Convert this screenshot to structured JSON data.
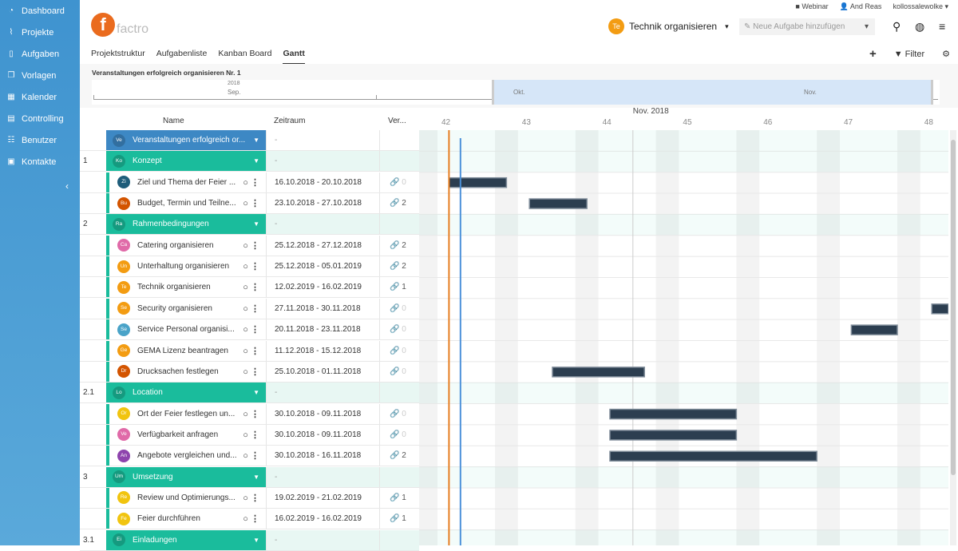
{
  "sidebar": {
    "items": [
      {
        "label": "Dashboard",
        "icon": "dashboard-icon",
        "glyph": "◔"
      },
      {
        "label": "Projekte",
        "icon": "chart-icon",
        "glyph": "⌇"
      },
      {
        "label": "Aufgaben",
        "icon": "file-icon",
        "glyph": "▯"
      },
      {
        "label": "Vorlagen",
        "icon": "copy-icon",
        "glyph": "❐"
      },
      {
        "label": "Kalender",
        "icon": "calendar-icon",
        "glyph": "▦"
      },
      {
        "label": "Controlling",
        "icon": "calculator-icon",
        "glyph": "▤"
      },
      {
        "label": "Benutzer",
        "icon": "users-icon",
        "glyph": "☷"
      },
      {
        "label": "Kontakte",
        "icon": "contact-icon",
        "glyph": "▣"
      }
    ],
    "collapse": "‹"
  },
  "logo": {
    "letter": "f",
    "text": "factro"
  },
  "topbar": {
    "webinar": "Webinar",
    "user": "And Reas",
    "account": "kollossalewolke ▾"
  },
  "context": {
    "initials": "Te",
    "title": "Technik organisieren",
    "chevron": "▾"
  },
  "new_task": {
    "placeholder": "Neue Aufgabe hinzufügen",
    "chevron": "▾"
  },
  "tabs": [
    {
      "label": "Projektstruktur"
    },
    {
      "label": "Aufgabenliste"
    },
    {
      "label": "Kanban Board"
    },
    {
      "label": "Gantt",
      "active": true
    }
  ],
  "toolbar": {
    "add": "+",
    "filter": "Filter"
  },
  "overview": {
    "title": "Veranstaltungen erfolgreich organisieren Nr. 1",
    "year": "2018",
    "months": [
      "Sep.",
      "Okt.",
      "Nov."
    ]
  },
  "columns": {
    "name": "Name",
    "period": "Zeitraum",
    "links": "Ver..."
  },
  "timeline": {
    "month": "Nov. 2018",
    "weeks": [
      42,
      43,
      44,
      45,
      46,
      47,
      48
    ]
  },
  "rows": [
    {
      "type": "root",
      "initials": "Ve",
      "name": "Veranstaltungen erfolgreich or...",
      "period": "-",
      "color": "#3d88c4"
    },
    {
      "type": "group",
      "num": "1",
      "initials": "Ko",
      "name": "Konzept",
      "period": "-"
    },
    {
      "type": "task",
      "initials": "Zi",
      "name": "Ziel und Thema der Feier ...",
      "period": "16.10.2018 - 20.10.2018",
      "links": "0",
      "color": "#1f5d7a",
      "start": "2018-10-16",
      "end": "2018-10-20"
    },
    {
      "type": "task",
      "initials": "Bu",
      "name": "Budget, Termin und Teilne...",
      "period": "23.10.2018 - 27.10.2018",
      "links": "2",
      "color": "#d35400",
      "start": "2018-10-23",
      "end": "2018-10-27"
    },
    {
      "type": "group",
      "num": "2",
      "initials": "Ra",
      "name": "Rahmenbedingungen",
      "period": "-"
    },
    {
      "type": "task",
      "initials": "Ca",
      "name": "Catering organisieren",
      "period": "25.12.2018 - 27.12.2018",
      "links": "2",
      "color": "#e06aa8",
      "start": "2018-12-25",
      "end": "2018-12-27"
    },
    {
      "type": "task",
      "initials": "Un",
      "name": "Unterhaltung organisieren",
      "period": "25.12.2018 - 05.01.2019",
      "links": "2",
      "color": "#f39c12",
      "start": "2018-12-25",
      "end": "2019-01-05"
    },
    {
      "type": "task",
      "initials": "Te",
      "name": "Technik organisieren",
      "period": "12.02.2019 - 16.02.2019",
      "links": "1",
      "color": "#f39c12",
      "start": "2019-02-12",
      "end": "2019-02-16"
    },
    {
      "type": "task",
      "initials": "Se",
      "name": "Security organisieren",
      "period": "27.11.2018 - 30.11.2018",
      "links": "0",
      "color": "#f39c12",
      "start": "2018-11-27",
      "end": "2018-11-30"
    },
    {
      "type": "task",
      "initials": "Se",
      "name": "Service Personal organisi...",
      "period": "20.11.2018 - 23.11.2018",
      "links": "0",
      "color": "#4aa3c8",
      "start": "2018-11-20",
      "end": "2018-11-23"
    },
    {
      "type": "task",
      "initials": "Ge",
      "name": "GEMA Lizenz beantragen",
      "period": "11.12.2018 - 15.12.2018",
      "links": "0",
      "color": "#f39c12",
      "start": "2018-12-11",
      "end": "2018-12-15"
    },
    {
      "type": "task",
      "initials": "Dr",
      "name": "Drucksachen festlegen",
      "period": "25.10.2018 - 01.11.2018",
      "links": "0",
      "color": "#d35400",
      "start": "2018-10-25",
      "end": "2018-11-01"
    },
    {
      "type": "group",
      "num": "2.1",
      "initials": "Lo",
      "name": "Location",
      "period": "-"
    },
    {
      "type": "task",
      "initials": "Or",
      "name": "Ort der Feier festlegen un...",
      "period": "30.10.2018 - 09.11.2018",
      "links": "0",
      "color": "#f1c40f",
      "start": "2018-10-30",
      "end": "2018-11-09"
    },
    {
      "type": "task",
      "initials": "Ve",
      "name": "Verfügbarkeit anfragen",
      "period": "30.10.2018 - 09.11.2018",
      "links": "0",
      "color": "#e06aa8",
      "start": "2018-10-30",
      "end": "2018-11-09"
    },
    {
      "type": "task",
      "initials": "An",
      "name": "Angebote vergleichen und...",
      "period": "30.10.2018 - 16.11.2018",
      "links": "2",
      "color": "#8e44ad",
      "start": "2018-10-30",
      "end": "2018-11-16"
    },
    {
      "type": "group",
      "num": "3",
      "initials": "Um",
      "name": "Umsetzung",
      "period": "-"
    },
    {
      "type": "task",
      "initials": "Re",
      "name": "Review und Optimierungs...",
      "period": "19.02.2019 - 21.02.2019",
      "links": "1",
      "color": "#f1c40f",
      "start": "2019-02-19",
      "end": "2019-02-21"
    },
    {
      "type": "task",
      "initials": "Fe",
      "name": "Feier durchführen",
      "period": "16.02.2019 - 16.02.2019",
      "links": "1",
      "color": "#f1c40f",
      "start": "2019-02-16",
      "end": "2019-02-16"
    },
    {
      "type": "group",
      "num": "3.1",
      "initials": "Ei",
      "name": "Einladungen",
      "period": "-"
    }
  ],
  "colors": {
    "group": "#1abc9c",
    "root": "#3d88c4",
    "bar": "#2c3e50",
    "today": "#4a90d9",
    "marker": "#e67e22"
  }
}
